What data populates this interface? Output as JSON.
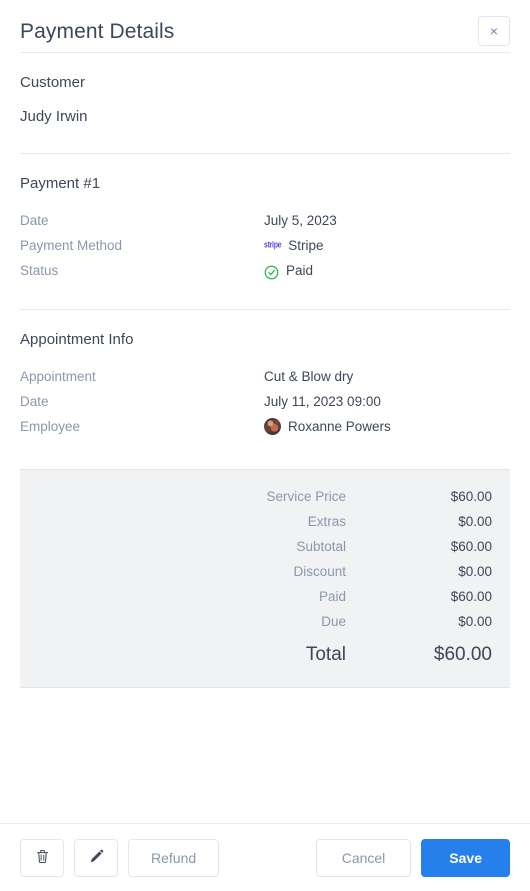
{
  "header": {
    "title": "Payment Details",
    "close_label": "×"
  },
  "customer": {
    "section_label": "Customer",
    "name": "Judy Irwin"
  },
  "payment": {
    "section_label": "Payment #1",
    "rows": [
      {
        "label": "Date",
        "value": "July 5, 2023"
      },
      {
        "label": "Payment Method",
        "value": "Stripe",
        "icon": "stripe-logo-icon"
      },
      {
        "label": "Status",
        "value": "Paid",
        "icon": "check-circle-icon"
      }
    ],
    "stripe_wordmark": "stripe",
    "status_color": "#2bb24c"
  },
  "appointment": {
    "section_label": "Appointment Info",
    "rows": [
      {
        "label": "Appointment",
        "value": "Cut & Blow dry"
      },
      {
        "label": "Date",
        "value": "July 11, 2023 09:00"
      },
      {
        "label": "Employee",
        "value": "Roxanne Powers",
        "icon": "avatar-icon"
      }
    ]
  },
  "totals": {
    "rows": [
      {
        "label": "Service Price",
        "value": "$60.00"
      },
      {
        "label": "Extras",
        "value": "$0.00"
      },
      {
        "label": "Subtotal",
        "value": "$60.00"
      },
      {
        "label": "Discount",
        "value": "$0.00"
      },
      {
        "label": "Paid",
        "value": "$60.00"
      },
      {
        "label": "Due",
        "value": "$0.00"
      }
    ],
    "grand": {
      "label": "Total",
      "value": "$60.00"
    }
  },
  "footer": {
    "delete_icon": "trash-icon",
    "edit_icon": "pencil-icon",
    "refund_label": "Refund",
    "cancel_label": "Cancel",
    "save_label": "Save",
    "save_color": "#2680eb"
  }
}
